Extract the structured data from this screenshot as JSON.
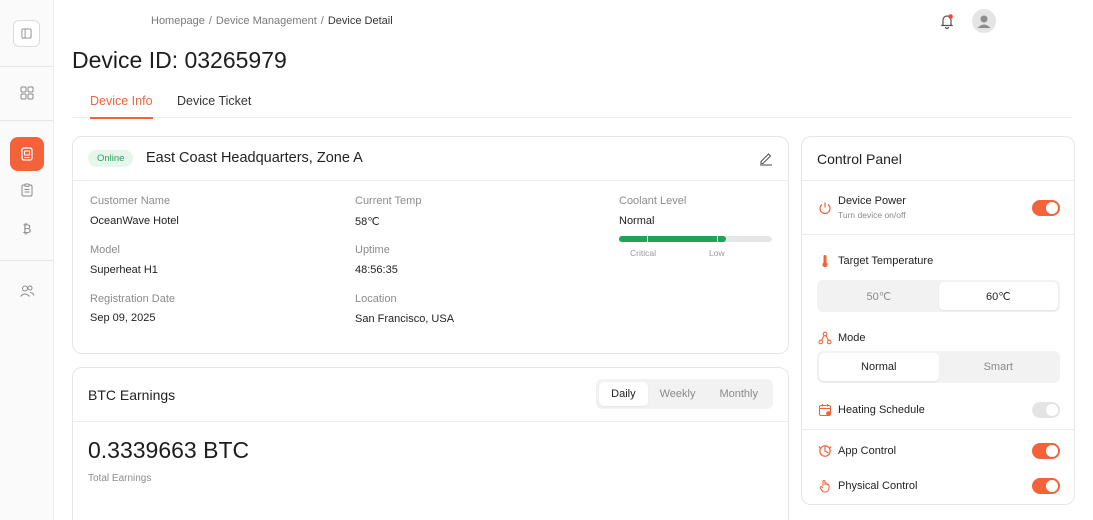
{
  "breadcrumb": {
    "home": "Homepage",
    "section": "Device Management",
    "current": "Device Detail",
    "separator": "/"
  },
  "page": {
    "title": "Device ID: 03265979"
  },
  "tabs": [
    {
      "label": "Device Info",
      "active": true
    },
    {
      "label": "Device Ticket",
      "active": false
    }
  ],
  "info": {
    "status": "Online",
    "site_name": "East Coast Headquarters, Zone A",
    "customer_name_label": "Customer Name",
    "customer_name": "OceanWave Hotel",
    "model_label": "Model",
    "model": "Superheat H1",
    "registration_label": "Registration Date",
    "registration": "Sep 09, 2025",
    "temp_label": "Current Temp",
    "temp": "58℃",
    "uptime_label": "Uptime",
    "uptime": "48:56:35",
    "location_label": "Location",
    "location": "San Francisco, USA",
    "coolant_label": "Coolant Level",
    "coolant": "Normal",
    "coolant_ticks": {
      "critical": "Critical",
      "low": "Low"
    },
    "coolant_fraction": 0.7
  },
  "btc": {
    "title": "BTC Earnings",
    "periods": [
      {
        "label": "Daily",
        "active": true
      },
      {
        "label": "Weekly",
        "active": false
      },
      {
        "label": "Monthly",
        "active": false
      }
    ],
    "amount": "0.3339663 BTC",
    "subtitle": "Total Earnings"
  },
  "control_panel": {
    "title": "Control Panel",
    "power_label": "Device Power",
    "power_sub": "Turn device on/off",
    "power_on": true,
    "target_temp_label": "Target Temperature",
    "temp_options": [
      {
        "label": "50℃",
        "active": false
      },
      {
        "label": "60℃",
        "active": true
      }
    ],
    "mode_label": "Mode",
    "mode_options": [
      {
        "label": "Normal",
        "active": true
      },
      {
        "label": "Smart",
        "active": false
      }
    ],
    "schedule_label": "Heating Schedule",
    "schedule_on": false,
    "app_control_label": "App Control",
    "app_control_on": true,
    "physical_control_label": "Physical Control",
    "physical_control_on": true
  },
  "colors": {
    "accent": "#f4623a",
    "success": "#27a35a",
    "coolant_green": "#1fa35a"
  },
  "icons": {
    "sidebar": [
      "sidebar-toggle-icon",
      "dashboard-icon",
      "device-icon",
      "clipboard-icon",
      "bitcoin-icon",
      "users-icon"
    ],
    "header": [
      "bell-icon",
      "user-avatar-icon"
    ]
  }
}
